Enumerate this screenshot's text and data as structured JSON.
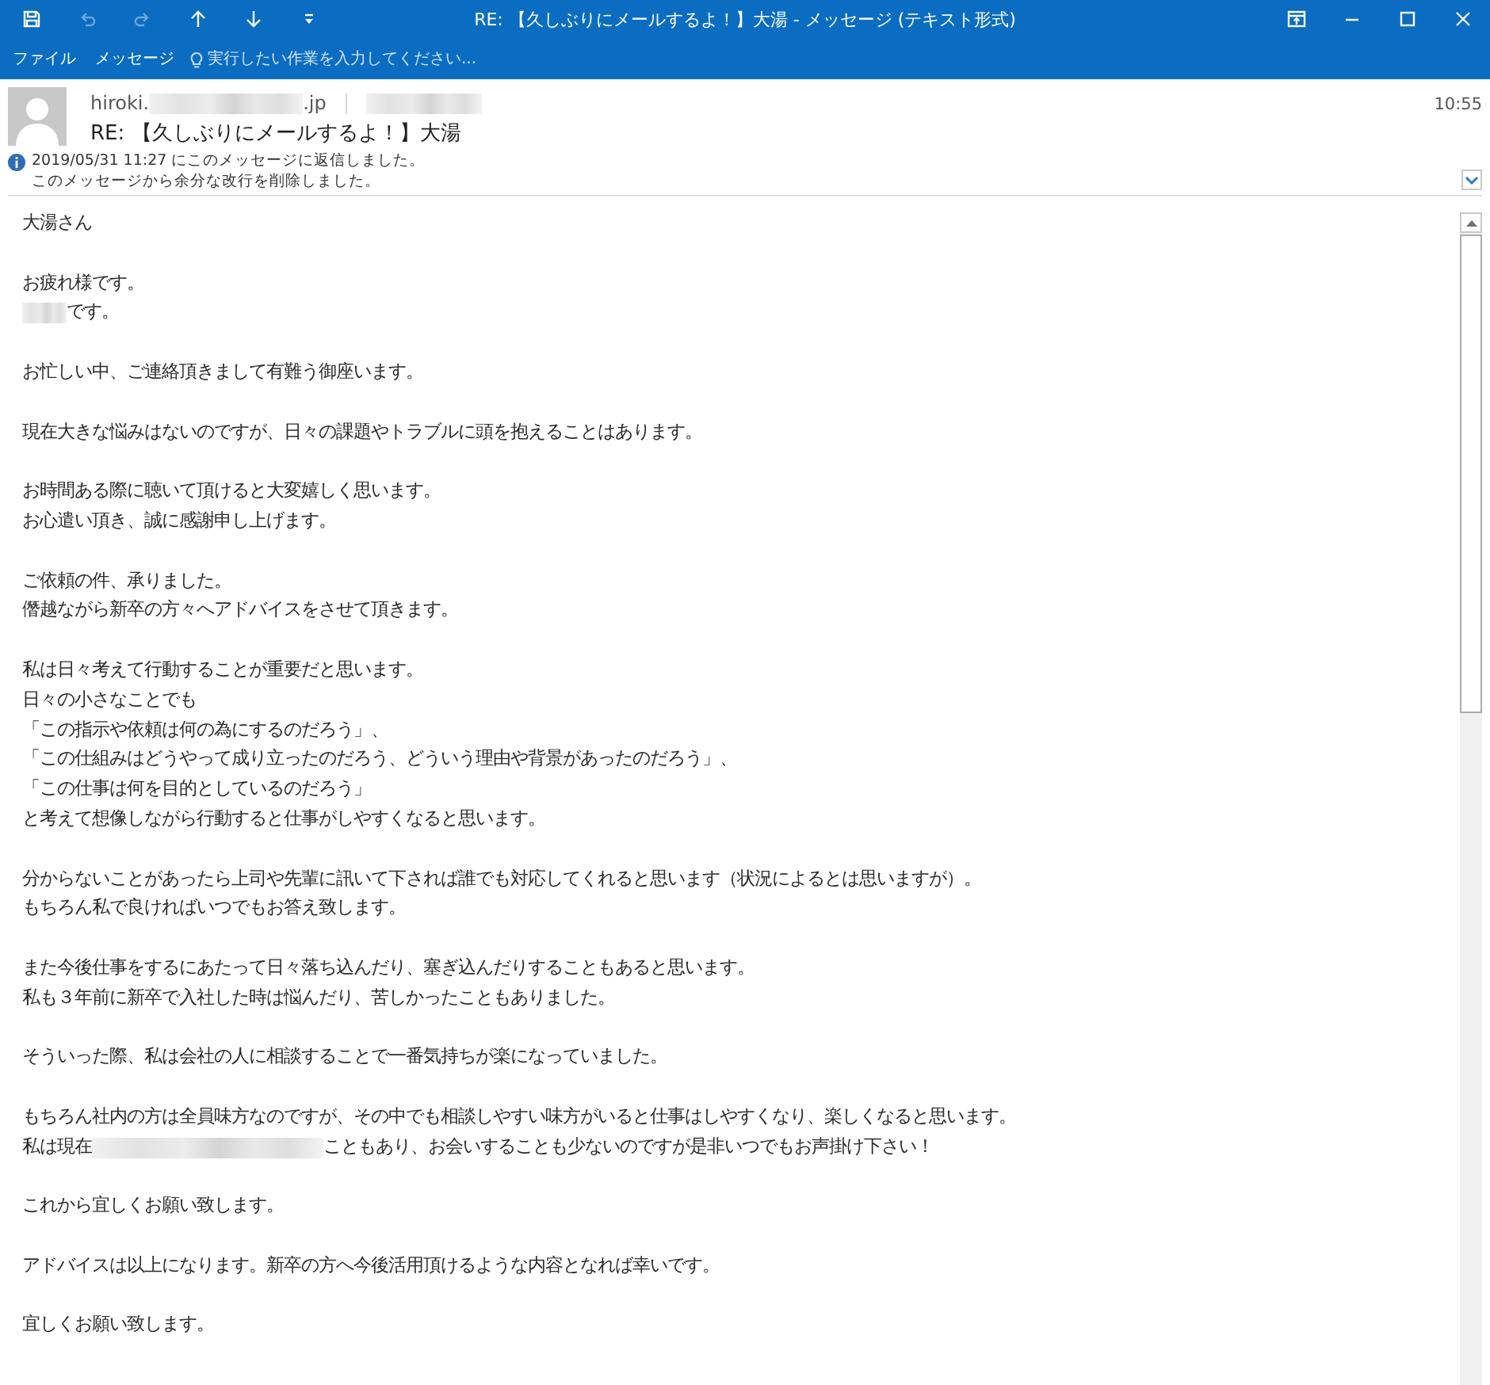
{
  "window": {
    "title": "RE: 【久しぶりにメールするよ！】大湯 - メッセージ (テキスト形式)",
    "quick_access": [
      {
        "kind": "save",
        "disabled": false
      },
      {
        "kind": "undo",
        "disabled": true
      },
      {
        "kind": "redo",
        "disabled": true
      },
      {
        "kind": "previous",
        "disabled": false
      },
      {
        "kind": "next",
        "disabled": false
      },
      {
        "kind": "customize",
        "disabled": false
      }
    ],
    "controls": [
      {
        "kind": "ribbon-options"
      },
      {
        "kind": "minimize"
      },
      {
        "kind": "maximize"
      },
      {
        "kind": "close"
      }
    ]
  },
  "ribbon": {
    "tabs": [
      {
        "label": "ファイル",
        "selected": false
      },
      {
        "label": "メッセージ",
        "selected": false
      }
    ],
    "tell_me": {
      "placeholder": "実行したい作業を入力してください..."
    }
  },
  "message": {
    "sender": {
      "kind": "redacted",
      "before": "hiroki.",
      "after": ".jp"
    },
    "recipient": {
      "kind": "redacted"
    },
    "time": "10:55",
    "subject": "RE: 【久しぶりにメールするよ！】大湯",
    "notices": [
      "2019/05/31 11:27 にこのメッセージに返信しました。",
      "このメッセージから余分な改行を削除しました。"
    ],
    "body": [
      [
        {
          "kind": "text",
          "text": "大湯さん"
        }
      ],
      [
        {
          "kind": "text",
          "text": "お疲れ様です。"
        },
        {
          "kind": "redacted",
          "after": "です。"
        }
      ],
      [
        {
          "kind": "text",
          "text": "お忙しい中、ご連絡頂きまして有難う御座います。"
        }
      ],
      [
        {
          "kind": "text",
          "text": "現在大きな悩みはないのですが、日々の課題やトラブルに頭を抱えることはあります。"
        }
      ],
      [
        {
          "kind": "text",
          "text": "お時間ある際に聴いて頂けると大変嬉しく思います。"
        },
        {
          "kind": "text",
          "text": "お心遣い頂き、誠に感謝申し上げます。"
        }
      ],
      [
        {
          "kind": "text",
          "text": "ご依頼の件、承りました。"
        },
        {
          "kind": "text",
          "text": "僭越ながら新卒の方々へアドバイスをさせて頂きます。"
        }
      ],
      [
        {
          "kind": "text",
          "text": "私は日々考えて行動することが重要だと思います。"
        },
        {
          "kind": "text",
          "text": "日々の小さなことでも"
        },
        {
          "kind": "text",
          "text": "「この指示や依頼は何の為にするのだろう」、"
        },
        {
          "kind": "text",
          "text": "「この仕組みはどうやって成り立ったのだろう、どういう理由や背景があったのだろう」、"
        },
        {
          "kind": "text",
          "text": "「この仕事は何を目的としているのだろう」"
        },
        {
          "kind": "text",
          "text": "と考えて想像しながら行動すると仕事がしやすくなると思います。"
        }
      ],
      [
        {
          "kind": "text",
          "text": "分からないことがあったら上司や先輩に訊いて下されば誰でも対応してくれると思います（状況によるとは思いますが）。"
        },
        {
          "kind": "text",
          "text": "もちろん私で良ければいつでもお答え致します。"
        }
      ],
      [
        {
          "kind": "text",
          "text": "また今後仕事をするにあたって日々落ち込んだり、塞ぎ込んだりすることもあると思います。"
        },
        {
          "kind": "text",
          "text": "私も３年前に新卒で入社した時は悩んだり、苦しかったこともありました。"
        }
      ],
      [
        {
          "kind": "text",
          "text": "そういった際、私は会社の人に相談することで一番気持ちが楽になっていました。"
        }
      ],
      [
        {
          "kind": "text",
          "text": "もちろん社内の方は全員味方なのですが、その中でも相談しやすい味方がいると仕事はしやすくなり、楽しくなると思います。"
        },
        {
          "kind": "redacted",
          "before": "私は現在",
          "after": "こともあり、お会いすることも少ないのですが是非いつでもお声掛け下さい！"
        }
      ],
      [
        {
          "kind": "text",
          "text": "これから宜しくお願い致します。"
        }
      ],
      [
        {
          "kind": "text",
          "text": "アドバイスは以上になります。新卒の方へ今後活用頂けるような内容となれば幸いです。"
        }
      ],
      [
        {
          "kind": "text",
          "text": "宜しくお願い致します。"
        }
      ]
    ]
  }
}
